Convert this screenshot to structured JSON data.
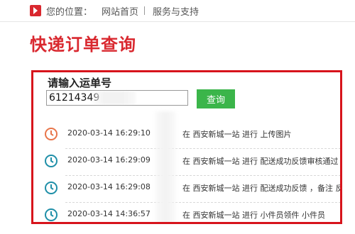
{
  "breadcrumb": {
    "label": "您的位置：",
    "home": "网站首页",
    "support": "服务与支持"
  },
  "page_title": "快递订单查询",
  "query": {
    "prompt": "请输入运单号",
    "input_value": "61214349",
    "button_label": "查询"
  },
  "records": [
    {
      "time": "2020-03-14 16:29:10",
      "desc": "在 西安新城一站 进行 上传图片",
      "icon": "clock-icon",
      "color": "#e8754a"
    },
    {
      "time": "2020-03-14 16:29:09",
      "desc": "在 西安新城一站 进行 配送成功反馈审核通过",
      "icon": "clock-icon",
      "color": "#1f8fa8"
    },
    {
      "time": "2020-03-14 16:29:08",
      "desc": "在 西安新城一站 进行 配送成功反馈 ，备注 反",
      "icon": "clock-icon",
      "color": "#1f8fa8"
    },
    {
      "time": "2020-03-14 14:36:57",
      "desc": "在 西安新城一站 进行 小件员领件 小件员",
      "icon": "clock-icon",
      "color": "#1f8fa8"
    }
  ],
  "colors": {
    "brand_red": "#d9282f",
    "box_border": "#d7141c",
    "button_green": "#3bb54a"
  }
}
